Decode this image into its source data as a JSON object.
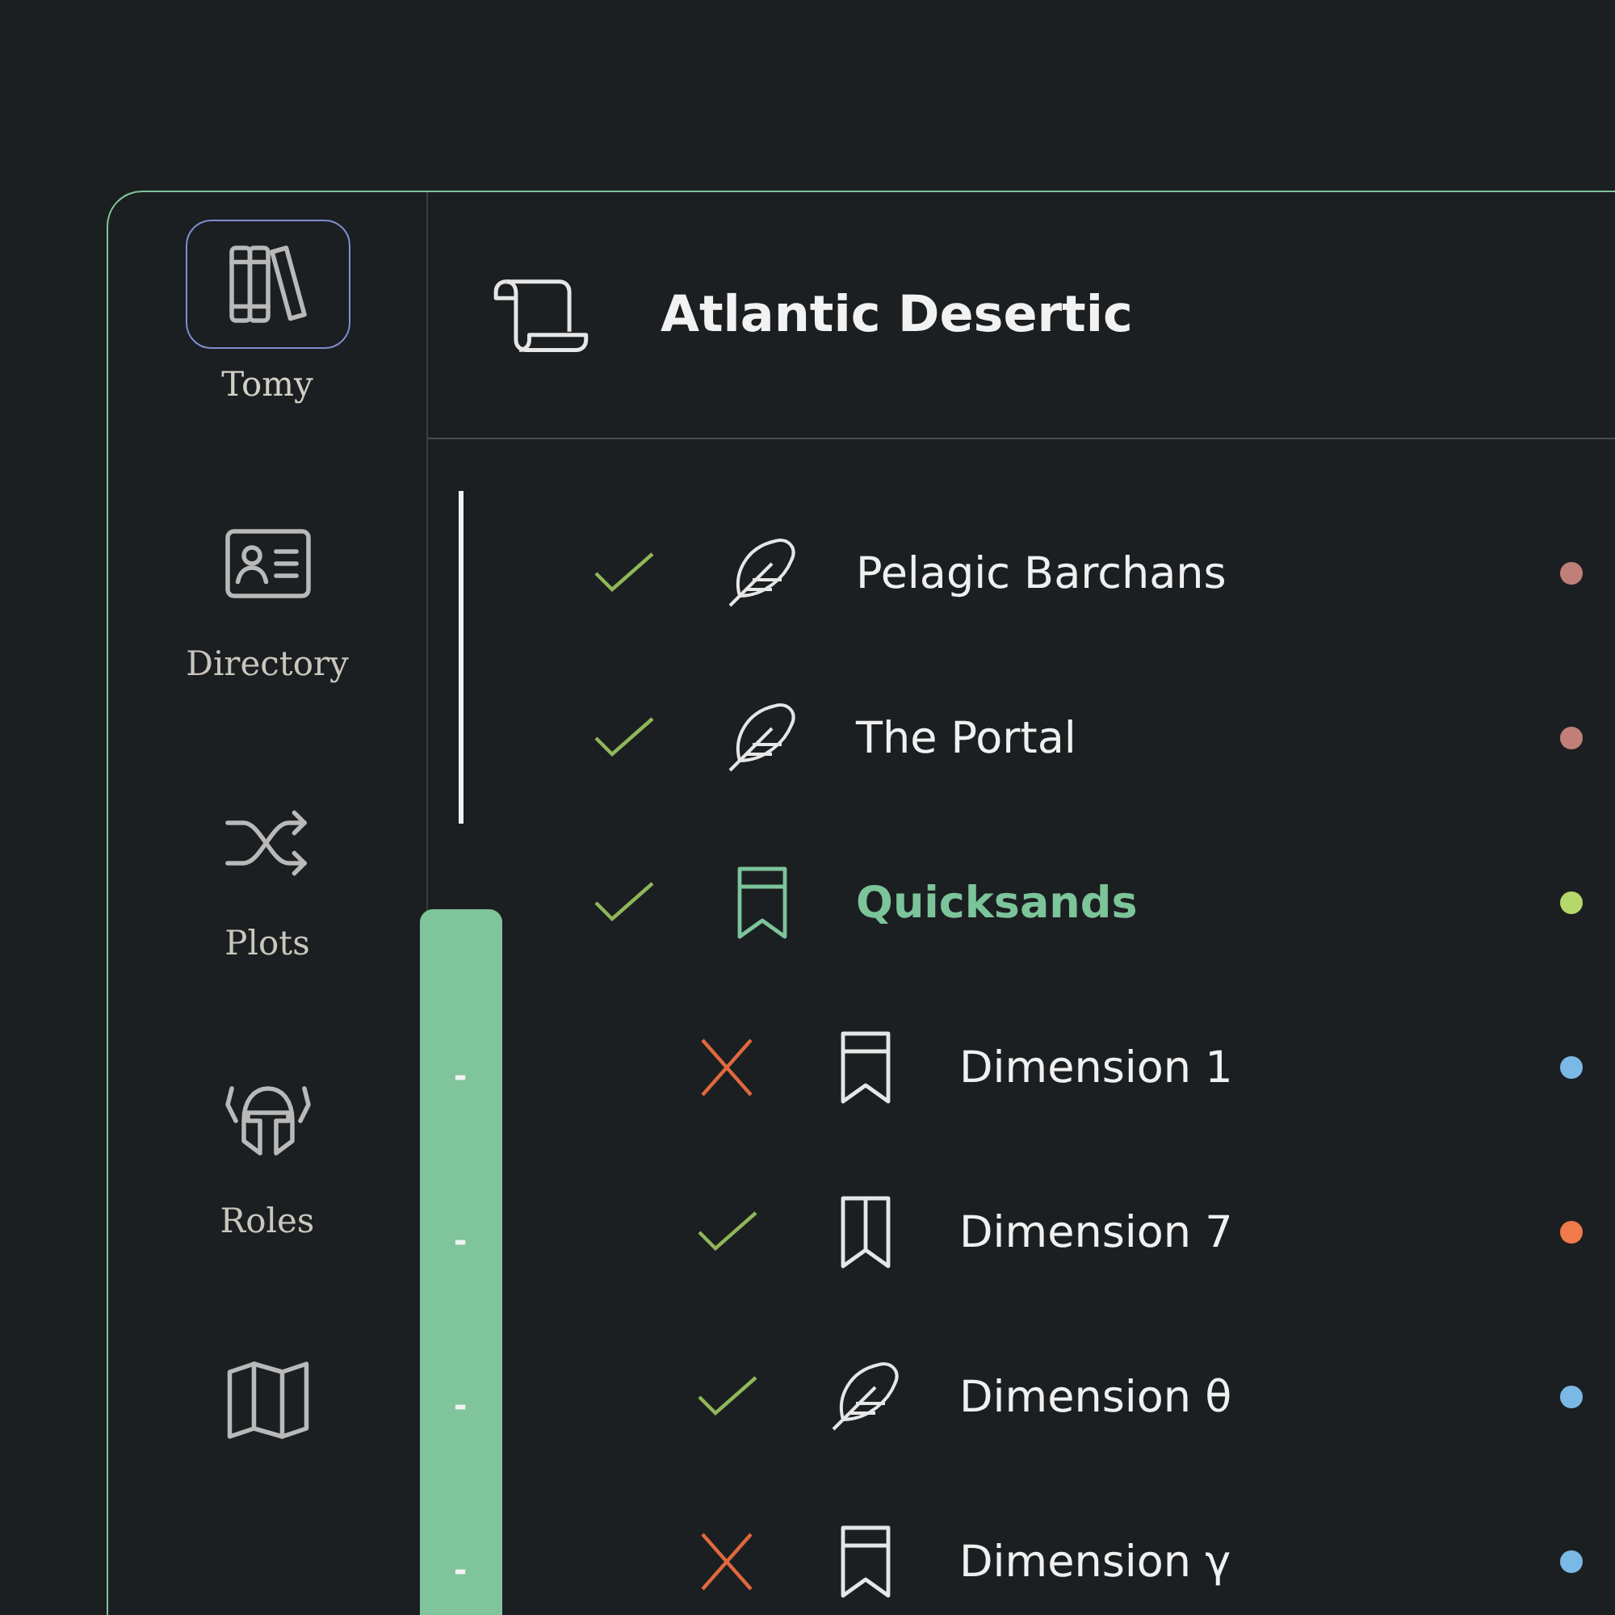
{
  "sidebar": {
    "items": [
      {
        "label": "Tomy",
        "kind": "books",
        "selected": true
      },
      {
        "label": "Directory",
        "kind": "contact-card",
        "selected": false
      },
      {
        "label": "Plots",
        "kind": "shuffle",
        "selected": false
      },
      {
        "label": "Roles",
        "kind": "helmet",
        "selected": false
      },
      {
        "kind": "map",
        "selected": false
      }
    ]
  },
  "header": {
    "title": "Atlantic Desertic"
  },
  "items": [
    {
      "name": "Pelagic Barchans",
      "done": true,
      "kind": "feather",
      "color": "#c17f7a",
      "selected": false,
      "expanded": false
    },
    {
      "name": "The Portal",
      "done": true,
      "kind": "feather",
      "color": "#c17f7a",
      "selected": false,
      "expanded": false
    },
    {
      "name": "Quicksands",
      "done": true,
      "kind": "bookmark",
      "color": "#b5d86a",
      "selected": true,
      "expanded": true,
      "children": [
        {
          "name": "Dimension 1",
          "done": false,
          "kind": "bookmark",
          "color": "#7ab8e6",
          "marker": "-"
        },
        {
          "name": "Dimension 7",
          "done": true,
          "kind": "book",
          "color": "#f07a4a",
          "marker": "-"
        },
        {
          "name": "Dimension θ",
          "done": true,
          "kind": "feather",
          "color": "#7ab8e6",
          "marker": "-"
        },
        {
          "name": "Dimension γ",
          "done": false,
          "kind": "bookmark",
          "color": "#7ab8e6",
          "marker": "-"
        }
      ]
    }
  ]
}
